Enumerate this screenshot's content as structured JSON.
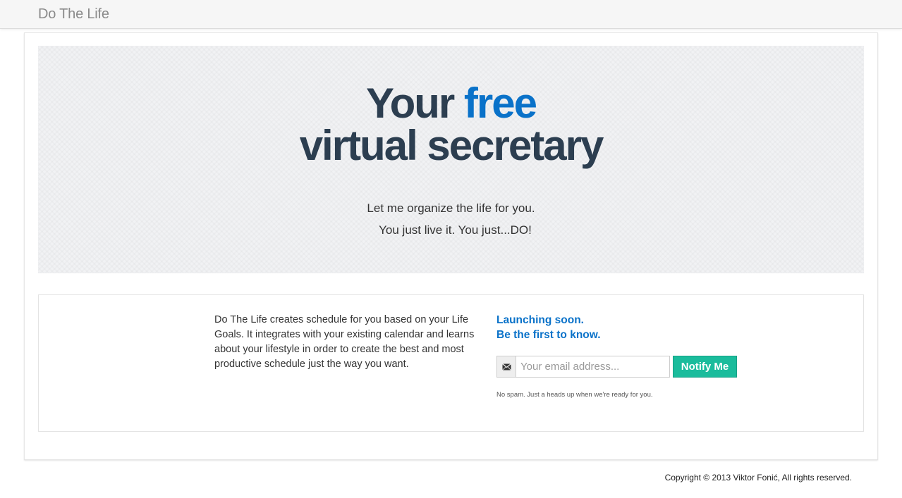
{
  "navbar": {
    "brand": "Do The Life"
  },
  "hero": {
    "title_prefix": "Your",
    "title_accent": "free",
    "title_line2": "virtual secretary",
    "subtitle_line1": "Let me organize the life for you.",
    "subtitle_line2": "You just live it. You just...DO!"
  },
  "info": {
    "description": "Do The Life creates schedule for you based on your Life Goals. It integrates with your existing calendar and learns about your lifestyle in order to create the best and most productive schedule just the way you want."
  },
  "signup": {
    "heading_line1": "Launching soon.",
    "heading_line2": "Be the first to know.",
    "email_placeholder": "Your email address...",
    "email_value": "",
    "button_label": "Notify Me",
    "note": "No spam. Just a heads up when we're ready for you."
  },
  "footer": {
    "copyright": "Copyright © 2013 Viktor Fonić, All rights reserved."
  },
  "icons": {
    "email": "envelope-icon"
  },
  "colors": {
    "accent_blue": "#0a72c9",
    "heading_dark": "#2c3e50",
    "button_green": "#1abc9c"
  }
}
